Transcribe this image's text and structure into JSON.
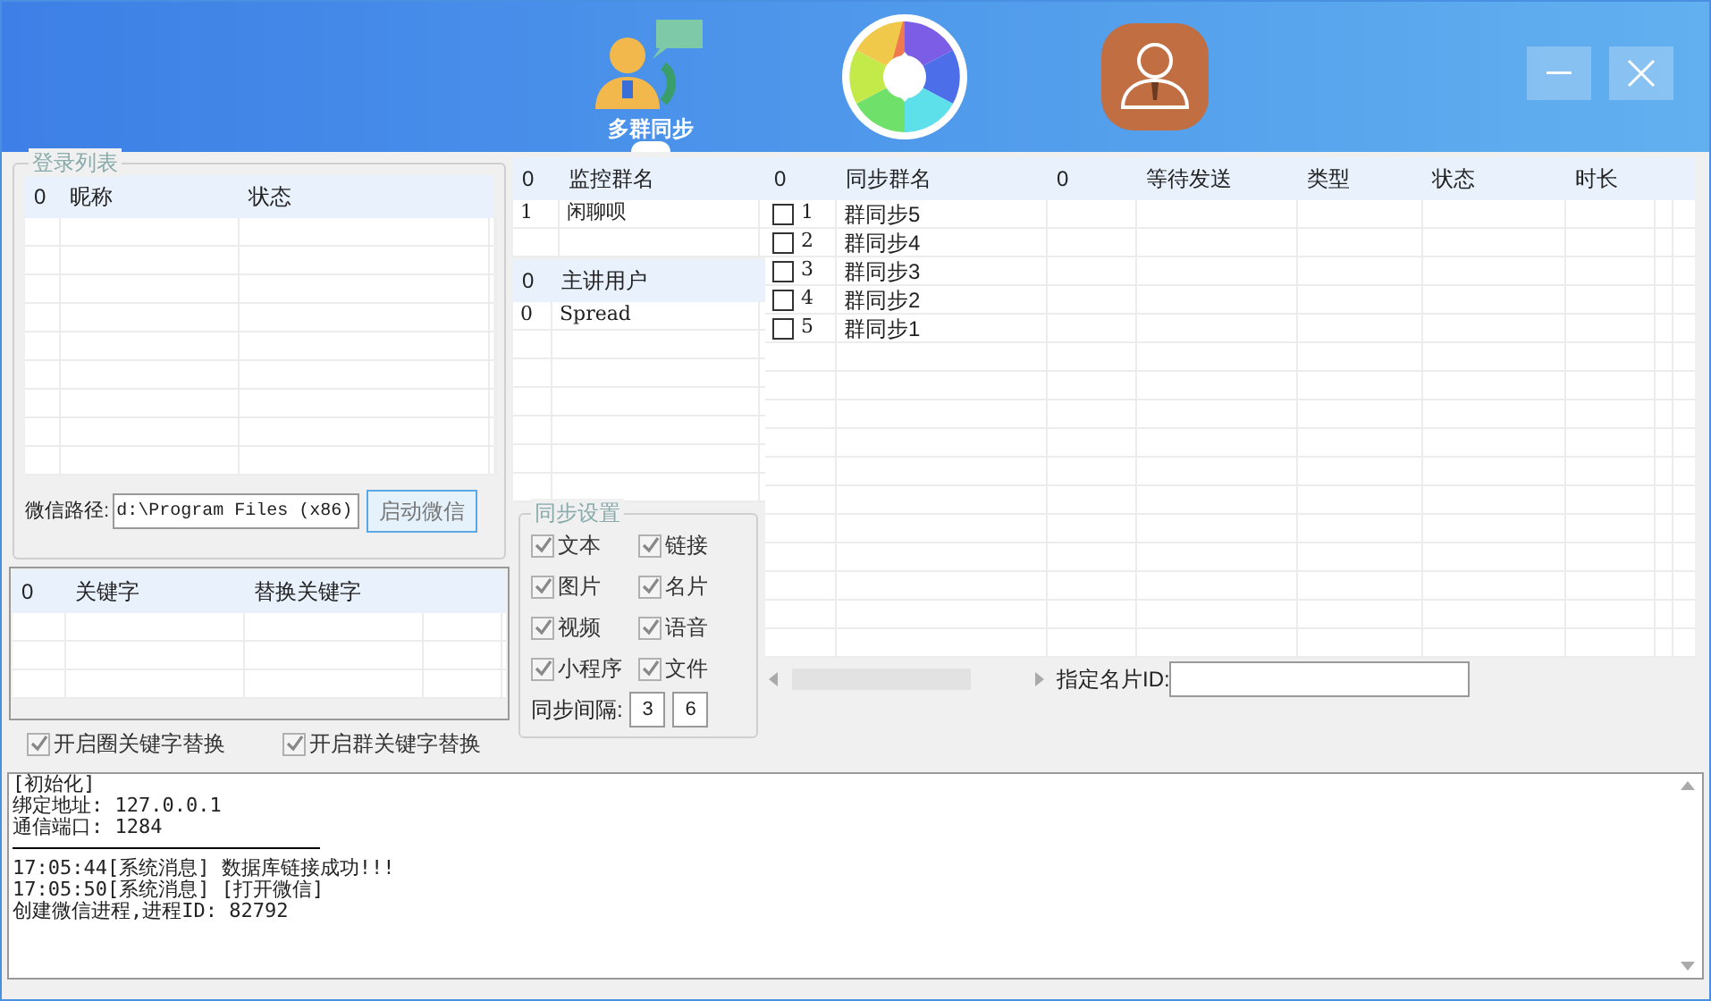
{
  "nav": [
    {
      "kind": "group-sync",
      "label": "多群同步",
      "selected": true
    },
    {
      "kind": "aperture",
      "selected": false
    },
    {
      "kind": "user",
      "selected": false
    }
  ],
  "login_list": {
    "title": "登录列表",
    "columns": [
      "0",
      "昵称",
      "状态"
    ]
  },
  "wechat_path": {
    "label": "微信路径:",
    "value": "d:\\Program Files (x86)",
    "button": "启动微信"
  },
  "keyword_table": {
    "columns": [
      "0",
      "关键字",
      "替换关键字"
    ]
  },
  "keyword_options": [
    {
      "label": "开启圈关键字替换",
      "checked": true,
      "disabled": true
    },
    {
      "label": "开启群关键字替换",
      "checked": true,
      "disabled": true
    }
  ],
  "monitor_table": {
    "columns": [
      "0",
      "监控群名"
    ],
    "rows": [
      [
        "1",
        "闲聊呗"
      ]
    ]
  },
  "speaker_table": {
    "columns": [
      "0",
      "主讲用户"
    ],
    "rows": [
      [
        "0",
        "Spread"
      ]
    ]
  },
  "sync_settings": {
    "title": "同步设置",
    "options": [
      {
        "label": "文本",
        "checked": true,
        "disabled": true
      },
      {
        "label": "链接",
        "checked": true,
        "disabled": true
      },
      {
        "label": "图片",
        "checked": true,
        "disabled": true
      },
      {
        "label": "名片",
        "checked": true,
        "disabled": true
      },
      {
        "label": "视频",
        "checked": true,
        "disabled": true
      },
      {
        "label": "语音",
        "checked": true,
        "disabled": true
      },
      {
        "label": "小程序",
        "checked": true,
        "disabled": true
      },
      {
        "label": "文件",
        "checked": true,
        "disabled": true
      }
    ],
    "interval_label": "同步间隔:",
    "interval_from": "3",
    "interval_to": "6"
  },
  "sync_groups": {
    "columns": [
      "0",
      "同步群名"
    ],
    "rows": [
      {
        "index": "1",
        "name": "群同步5",
        "checked": false
      },
      {
        "index": "2",
        "name": "群同步4",
        "checked": false
      },
      {
        "index": "3",
        "name": "群同步3",
        "checked": false
      },
      {
        "index": "4",
        "name": "群同步2",
        "checked": false
      },
      {
        "index": "5",
        "name": "群同步1",
        "checked": false
      }
    ]
  },
  "queue_table": {
    "columns": [
      "0",
      "等待发送",
      "类型",
      "状态",
      "时长"
    ]
  },
  "card_id": {
    "label": "指定名片ID:"
  },
  "log": [
    {
      "kind": "text",
      "text": "[初始化]"
    },
    {
      "kind": "text",
      "text": "绑定地址: 127.0.0.1"
    },
    {
      "kind": "text",
      "text": "通信端口: 1284"
    },
    {
      "kind": "rule"
    },
    {
      "kind": "text",
      "text": "17:05:44[系统消息] 数据库链接成功!!!"
    },
    {
      "kind": "text",
      "text": "17:05:50[系统消息] [打开微信]"
    },
    {
      "kind": "text",
      "text": "创建微信进程,进程ID: 82792"
    }
  ]
}
